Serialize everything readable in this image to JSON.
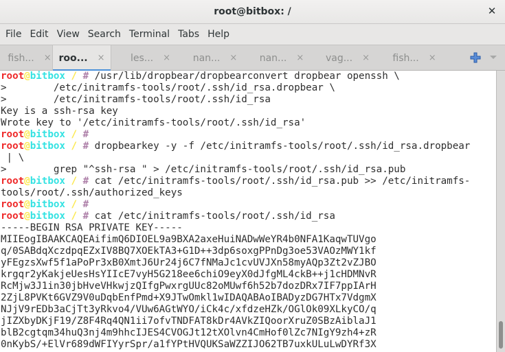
{
  "window": {
    "title": "root@bitbox: /",
    "close_icon": "close-icon"
  },
  "menu": [
    "File",
    "Edit",
    "View",
    "Search",
    "Terminal",
    "Tabs",
    "Help"
  ],
  "tabs": [
    {
      "label": "fish...",
      "active": false
    },
    {
      "label": "roo...",
      "active": true
    },
    {
      "label": "les...",
      "active": false
    },
    {
      "label": "nan...",
      "active": false
    },
    {
      "label": "nan...",
      "active": false
    },
    {
      "label": "vag...",
      "active": false
    },
    {
      "label": "fish...",
      "active": false
    }
  ],
  "tab_close_glyph": "×",
  "colors": {
    "accent": "#4a90d9",
    "prompt_user": "#ef2929",
    "prompt_host": "#34e2e2",
    "prompt_dir": "#fce94f",
    "prompt_hash": "#ad7fa8"
  },
  "prompt": {
    "user": "root",
    "at": "@",
    "host": "bitbox",
    "dir": " / ",
    "hash": "#"
  },
  "terminal_lines": [
    {
      "prompt": true,
      "text": " /usr/lib/dropbear/dropbearconvert dropbear openssh \\"
    },
    {
      "prompt": false,
      "text": ">        /etc/initramfs-tools/root/.ssh/id_rsa.dropbear \\"
    },
    {
      "prompt": false,
      "text": ">        /etc/initramfs-tools/root/.ssh/id_rsa"
    },
    {
      "prompt": false,
      "text": "Key is a ssh-rsa key"
    },
    {
      "prompt": false,
      "text": "Wrote key to '/etc/initramfs-tools/root/.ssh/id_rsa'"
    },
    {
      "prompt": true,
      "text": ""
    },
    {
      "prompt": true,
      "text": " dropbearkey -y -f /etc/initramfs-tools/root/.ssh/id_rsa.dropbear"
    },
    {
      "prompt": false,
      "text": " | \\"
    },
    {
      "prompt": false,
      "text": ">        grep \"^ssh-rsa \" > /etc/initramfs-tools/root/.ssh/id_rsa.pub"
    },
    {
      "prompt": true,
      "text": " cat /etc/initramfs-tools/root/.ssh/id_rsa.pub >> /etc/initramfs-"
    },
    {
      "prompt": false,
      "text": "tools/root/.ssh/authorized_keys"
    },
    {
      "prompt": true,
      "text": ""
    },
    {
      "prompt": true,
      "text": " cat /etc/initramfs-tools/root/.ssh/id_rsa"
    },
    {
      "prompt": false,
      "text": "-----BEGIN RSA PRIVATE KEY-----"
    },
    {
      "prompt": false,
      "text": "MIIEogIBAAKCAQEAifimQ6DIOEL9a9BXA2axeHuiNADwWeYR4b0NFA1KaqwTUVgo"
    },
    {
      "prompt": false,
      "text": "q/0SABdqXczdpqEZxIV8BQ7XOEkTA3+G1D++3dp6soxgPPnDg3oe53VAOzMWY1kf"
    },
    {
      "prompt": false,
      "text": "yFEgzsXwf5f1aPoPr3xB0XmtJ6Ur24j6C7fNMaJc1cvUVJXn58myAQp3Zt2vZJBO"
    },
    {
      "prompt": false,
      "text": "krgqr2yKakjeUesHsYIIcE7vyH5G218ee6chiO9eyX0dJfgML4ckB++j1cHDMNvR"
    },
    {
      "prompt": false,
      "text": "RcMjw3J1in30jbHveVHkwjzQIfgPwxrgUUc82oMUwf6h52b7dozDRx7IF7ppIArH"
    },
    {
      "prompt": false,
      "text": "2ZjL8PVKt6GVZ9V0uDqbEnfPmd+X9JTwOmkl1wIDAQABAoIBADyzDG7HTx7VdgmX"
    },
    {
      "prompt": false,
      "text": "NJjV9rEDb3aCjTt3yRkvo4/VUw6AGtWYO/iCk4c/xfdzeHZk/OGlOk09XLkyCO/q"
    },
    {
      "prompt": false,
      "text": "jIZXbyDKjF19/Z8F4Rq4QN1ii7ofvTNDFAT8kDr4AVkZIQoorXruZ0SBzAiblaJ1"
    },
    {
      "prompt": false,
      "text": "blB2cgtqm34huQ3nj4m9hhcIJES4CVOGJt12tXOlvn4CmHof0lZc7NIgY9zh4+zR"
    },
    {
      "prompt": false,
      "text": "0nKybS/+ElVr689dWFIYyrSpr/a1fYPtHVQUKSaWZZIJO62TB7uxkULuLwDYRf3X"
    }
  ]
}
